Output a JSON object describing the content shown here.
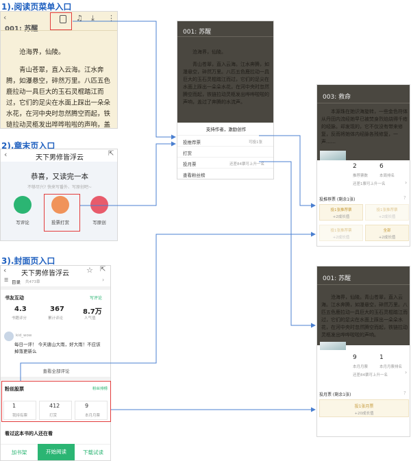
{
  "section1": {
    "heading": "1).阅读页菜单入口",
    "chapter": "001: 苏醒",
    "p1": "沧海界，仙陵。",
    "p2": "青山苍翠，直入云海。江水奔腾，如瀑悬空，碎然万里。八匹五色鹿拉动一具巨大的玉石灵棍踏江而过，它们的足尖在水面上踩出一朵朵水花，在河中央时忽然腾空而起，铁链拉动灵柩发出哗哗啦啦的声响，盖过了奔腾的水流声。"
  },
  "section2": {
    "heading": "2).章末页入口",
    "title": "天下男修皆浮云",
    "congrats": "恭喜，又读完一本",
    "sub": "不够尽兴? 快来写番外、写原创吧~",
    "actions": [
      "写评论",
      "投票打赏",
      "写原创"
    ]
  },
  "section3": {
    "heading": "3).封面页入口",
    "title": "天下男修皆浮云",
    "toc": "目录",
    "toc_count": "共473章",
    "interact": "书友互动",
    "write_comment": "写评论",
    "stats": [
      {
        "value": "4.3",
        "label": "书籍评分"
      },
      {
        "value": "367",
        "label": "累计评论"
      },
      {
        "value": "8.7万",
        "label": "人气值"
      }
    ],
    "user": "kid_wow",
    "comment": "每日一评！ 今天唐山大雨，好大雨！不应该掉落更新么",
    "view_all": "查看全部评论",
    "fans": "粉丝股票",
    "fans_rank": "粉丝排榜",
    "fans_stats": [
      {
        "value": "1",
        "label": "我持有票"
      },
      {
        "value": "412",
        "label": "打赏"
      },
      {
        "value": "9",
        "label": "本月月票"
      }
    ],
    "also_read": "看过这本书的人还在看",
    "bottom": [
      "加书架",
      "开始阅读",
      "下载试读"
    ]
  },
  "menu": {
    "chapter": "001: 苏醒",
    "p1": "沧海界，仙陵。",
    "p2": "青山苍翠，直入云海。江水奔腾，如瀑悬空，碎然万里。八匹五色鹿拉动一具巨大的玉石灵棍踏江而过，它们的足尖在水面上踩出一朵朵水花，在河中央时忽然腾空而起，铁链拉动灵柩发出哗哗啦啦的声响，盖过了奔腾的水流声。",
    "support": "支持作者，激励创作",
    "rows": [
      {
        "label": "投推荐票",
        "value": "可投1张"
      },
      {
        "label": "打赏",
        "value": ""
      },
      {
        "label": "投月票",
        "value": "还差84票可上升一名"
      },
      {
        "label": "查看粉丝榜",
        "value": ""
      }
    ]
  },
  "panel_top": {
    "chapter": "003: 救命",
    "text": "本源珠在她识海旋转，一些金色符体从丹田内流经她早已被焚身烈焰烧得千疮的经脉。却发现的，它不仅没有带来修复，反而将她体内经脉各残修复，一声……",
    "votes": "2",
    "votes_label": "推荐票数",
    "rank": "6",
    "rank_label": "本周排名",
    "next_hint": "还差1票可上升一名",
    "section": "投推荐票 (剩余1张)",
    "options": [
      {
        "title": "投1张推荐票",
        "sub": "+2成长值"
      },
      {
        "title": "投1张推荐票",
        "sub": "+2成长值"
      },
      {
        "title": "投1张推荐票",
        "sub": "+2成长值"
      },
      {
        "title": "全部",
        "sub": "+2成长值"
      }
    ]
  },
  "panel_bottom": {
    "chapter": "001: 苏醒",
    "text": "沧海界，仙陵。青山苍翠，直入云海。江水奔腾，如瀑悬空，碎然万里。八匹五色鹿拉动一具巨大的玉石灵棍踏江而过，它们的足尖在水面上踩出一朵朵水花，在河中央时忽然腾空而起，铁链拉动灵柩发出哗哗啦啦的声响。",
    "votes": "9",
    "votes_label": "本月月票",
    "rank": "1",
    "rank_label": "本月月票排名",
    "next_hint": "还差84票可上升一名",
    "section": "投月票 (剩余1张)",
    "option_title": "投1张月票",
    "option_sub": "+20成长值"
  },
  "colors": {
    "heading": "#1e5fbf",
    "highlight": "#e23b3b",
    "connector": "#4a7fd0",
    "accent": "#2bb573"
  }
}
